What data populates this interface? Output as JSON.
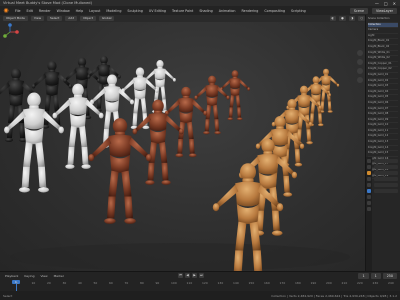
{
  "window": {
    "title": "Virtual Meet Buddy's Stove Mod (Clone Mulioned)",
    "controls": [
      "—",
      "□",
      "✕"
    ]
  },
  "menubar": {
    "items": [
      "File",
      "Edit",
      "Render",
      "Window",
      "Help",
      "Layout",
      "Modeling",
      "Sculpting",
      "UV Editing",
      "Texture Paint",
      "Shading",
      "Animation",
      "Rendering",
      "Compositing",
      "Scripting"
    ],
    "scene_label": "Scene",
    "layer_label": "ViewLayer"
  },
  "toolbar": {
    "mode": "Object Mode",
    "view": "View",
    "select": "Select",
    "add": "Add",
    "object": "Object",
    "transform": "Global"
  },
  "timeline": {
    "controls": [
      "Playback",
      "Keying",
      "View",
      "Marker"
    ],
    "current_frame": "1",
    "start": "1",
    "end": "250",
    "ticks": [
      "0",
      "10",
      "20",
      "30",
      "40",
      "50",
      "60",
      "70",
      "80",
      "90",
      "100",
      "110",
      "120",
      "130",
      "140",
      "150",
      "160",
      "170",
      "180",
      "190",
      "200",
      "210",
      "220",
      "230",
      "240"
    ]
  },
  "statusbar": {
    "left": "Select",
    "right": "Collection | Verts 2,484,920 | Faces 2,469,624 | Tris 4,939,248 | Objects 0/28 | 3.1.2"
  },
  "outliner_rows": [
    "Scene Collection",
    "Collection",
    "Camera",
    "Light",
    "Knight_Black_01",
    "Knight_Black_02",
    "Knight_White_01",
    "Knight_White_02",
    "Knight_Copper_01",
    "Knight_Copper_02",
    "Knight_Gold_01",
    "Knight_Gold_02",
    "Knight_Gold_03",
    "Knight_Gold_04",
    "Knight_Gold_05",
    "Knight_Gold_06",
    "Knight_Gold_07",
    "Knight_Gold_08",
    "Knight_Gold_09",
    "Knight_Gold_10",
    "Knight_Gold_11",
    "Knight_Gold_12",
    "Knight_Gold_13",
    "Knight_Gold_14",
    "Knight_Gold_15",
    "Knight_Gold_16",
    "Knight_Gold_17",
    "Knight_Gold_18",
    "Knight_Gold_19"
  ],
  "colors": {
    "gold": "#b87a3f",
    "copper": "#7a3a24",
    "white": "#cfcfcf",
    "black": "#1b1b1b",
    "accent_blue": "#3a78c9",
    "logo_orange": "#ff8a1f"
  }
}
